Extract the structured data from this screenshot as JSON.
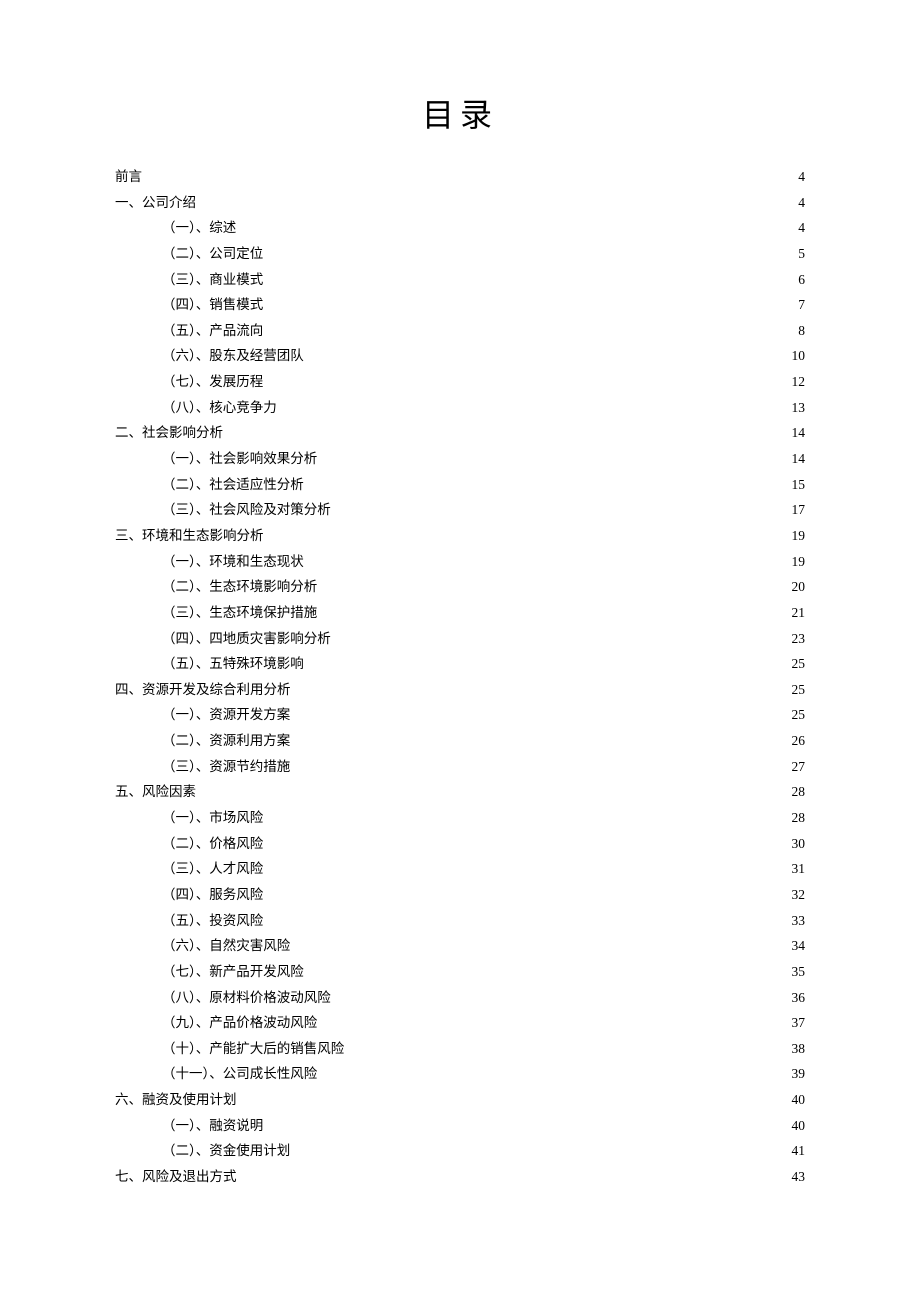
{
  "title": "目录",
  "entries": [
    {
      "level": 1,
      "label": "前言",
      "page": "4"
    },
    {
      "level": 1,
      "label": "一、公司介绍",
      "page": "4"
    },
    {
      "level": 2,
      "label": "（一）、综述",
      "page": "4"
    },
    {
      "level": 2,
      "label": "（二）、公司定位",
      "page": "5"
    },
    {
      "level": 2,
      "label": "（三）、商业模式",
      "page": "6"
    },
    {
      "level": 2,
      "label": "（四）、销售模式",
      "page": "7"
    },
    {
      "level": 2,
      "label": "（五）、产品流向",
      "page": "8"
    },
    {
      "level": 2,
      "label": "（六）、股东及经营团队",
      "page": "10"
    },
    {
      "level": 2,
      "label": "（七）、发展历程",
      "page": "12"
    },
    {
      "level": 2,
      "label": "（八）、核心竞争力",
      "page": "13"
    },
    {
      "level": 1,
      "label": "二、社会影响分析",
      "page": "14"
    },
    {
      "level": 2,
      "label": "（一）、社会影响效果分析",
      "page": "14"
    },
    {
      "level": 2,
      "label": "（二）、社会适应性分析",
      "page": "15"
    },
    {
      "level": 2,
      "label": "（三）、社会风险及对策分析",
      "page": "17"
    },
    {
      "level": 1,
      "label": "三、环境和生态影响分析",
      "page": "19"
    },
    {
      "level": 2,
      "label": "（一）、环境和生态现状",
      "page": "19"
    },
    {
      "level": 2,
      "label": "（二）、生态环境影响分析",
      "page": "20"
    },
    {
      "level": 2,
      "label": "（三）、生态环境保护措施",
      "page": "21"
    },
    {
      "level": 2,
      "label": "（四）、四地质灾害影响分析",
      "page": "23"
    },
    {
      "level": 2,
      "label": "（五）、五特殊环境影响",
      "page": "25"
    },
    {
      "level": 1,
      "label": "四、资源开发及综合利用分析",
      "page": "25"
    },
    {
      "level": 2,
      "label": "（一）、资源开发方案",
      "page": "25"
    },
    {
      "level": 2,
      "label": "（二）、资源利用方案",
      "page": "26"
    },
    {
      "level": 2,
      "label": "（三）、资源节约措施",
      "page": "27"
    },
    {
      "level": 1,
      "label": "五、风险因素",
      "page": "28"
    },
    {
      "level": 2,
      "label": "（一）、市场风险",
      "page": "28"
    },
    {
      "level": 2,
      "label": "（二）、价格风险",
      "page": "30"
    },
    {
      "level": 2,
      "label": "（三）、人才风险",
      "page": "31"
    },
    {
      "level": 2,
      "label": "（四）、服务风险",
      "page": "32"
    },
    {
      "level": 2,
      "label": "（五）、投资风险",
      "page": "33"
    },
    {
      "level": 2,
      "label": "（六）、自然灾害风险",
      "page": "34"
    },
    {
      "level": 2,
      "label": "（七）、新产品开发风险",
      "page": "35"
    },
    {
      "level": 2,
      "label": "（八）、原材料价格波动风险",
      "page": "36"
    },
    {
      "level": 2,
      "label": "（九）、产品价格波动风险",
      "page": "37"
    },
    {
      "level": 2,
      "label": "（十）、产能扩大后的销售风险",
      "page": "38"
    },
    {
      "level": 2,
      "label": "（十一）、公司成长性风险",
      "page": "39"
    },
    {
      "level": 1,
      "label": "六、融资及使用计划",
      "page": "40"
    },
    {
      "level": 2,
      "label": "（一）、融资说明",
      "page": "40"
    },
    {
      "level": 2,
      "label": "（二）、资金使用计划",
      "page": "41"
    },
    {
      "level": 1,
      "label": "七、风险及退出方式",
      "page": "43"
    }
  ]
}
